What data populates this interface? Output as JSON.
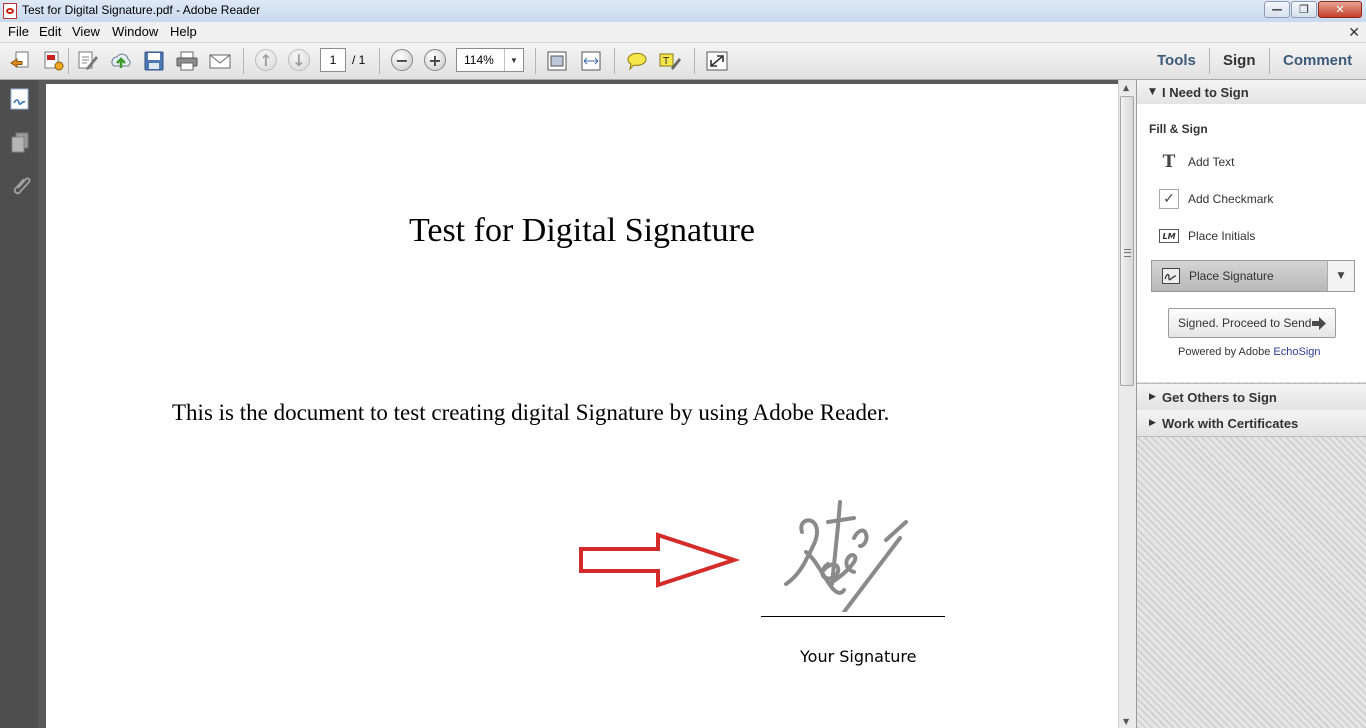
{
  "window": {
    "title": "Test for Digital Signature.pdf - Adobe Reader",
    "minimize_glyph": "—",
    "maximize_glyph": "❐",
    "close_glyph": "✕"
  },
  "menu": {
    "items": [
      "File",
      "Edit",
      "View",
      "Window",
      "Help"
    ],
    "close_glyph": "✕"
  },
  "toolbar": {
    "page_current": "1",
    "page_total": "/ 1",
    "zoom": "114%",
    "zoom_out_glyph": "−",
    "zoom_in_glyph": "+",
    "prev_glyph": "↑",
    "next_glyph": "↓",
    "dropdown_glyph": "▼",
    "icons": [
      "create-pdf-icon",
      "convert-pdf-icon",
      "edit-pdf-icon",
      "upload-icon",
      "save-icon",
      "print-icon",
      "email-icon",
      "prev-page-icon",
      "next-page-icon",
      "zoom-out-icon",
      "zoom-in-icon",
      "fit-page-icon",
      "fit-width-icon",
      "comment-icon",
      "highlight-icon",
      "fullscreen-icon"
    ]
  },
  "panel_tabs": {
    "tools": "Tools",
    "sign": "Sign",
    "comment": "Comment"
  },
  "document": {
    "title": "Test for Digital Signature",
    "body": "This is the document to test creating digital Signature by using Adobe Reader.",
    "signature_label": "Your Signature",
    "arrow_color": "#d42a2a",
    "signature_color": "#8a8a8a"
  },
  "right_panel": {
    "need_to_sign": "I Need to Sign",
    "fill_sign": "Fill & Sign",
    "add_text": "Add Text",
    "add_text_glyph": "T",
    "add_checkmark": "Add Checkmark",
    "check_glyph": "✓",
    "place_initials": "Place Initials",
    "initials_glyph": "LM",
    "place_signature": "Place Signature",
    "proceed": "Signed. Proceed to Send",
    "powered_prefix": "Powered by Adobe",
    "powered_link": "EchoSign",
    "get_others": "Get Others to Sign",
    "certificates": "Work with Certificates",
    "expanded_glyph": "▼",
    "collapsed_glyph": "▶"
  },
  "colors": {
    "accent_tab": "#3d5a7a",
    "link": "#2a3f9a"
  }
}
